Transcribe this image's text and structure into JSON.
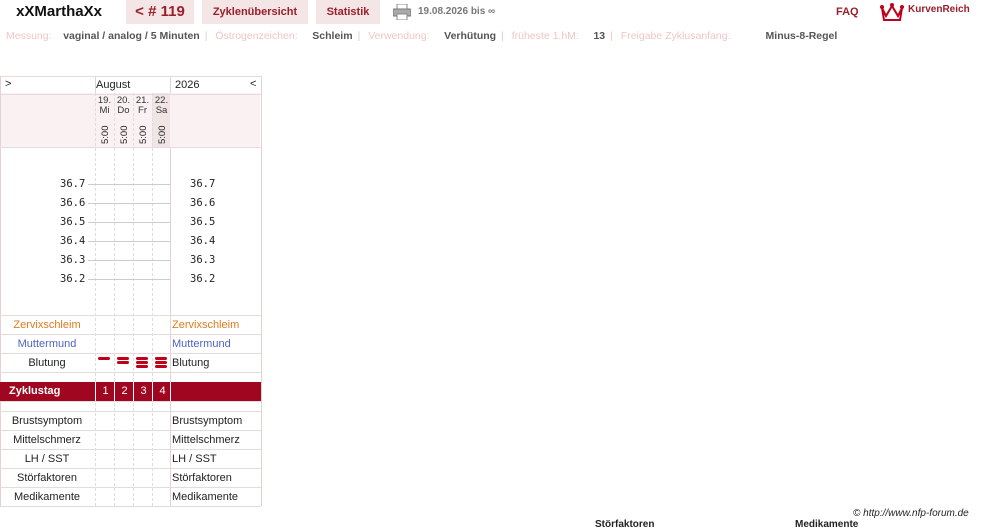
{
  "header": {
    "username": "xXMarthaXx",
    "cycle_tab": "< # 119",
    "overview_tab": "Zyklenübersicht",
    "stats_tab": "Statistik",
    "date_range": "19.08.2026 bis ∞",
    "faq": "FAQ",
    "brand": "KurvenReich"
  },
  "info": {
    "measure_label": "Messung:",
    "measure_value": "vaginal / analog / 5 Minuten",
    "estrogen_label": "Östrogenzeichen:",
    "estrogen_value": "Schleim",
    "usage_label": "Verwendung:",
    "usage_value": "Verhütung",
    "hm_label": "früheste 1.hM:",
    "hm_value": "13",
    "release_label": "Freigabe Zyklusanfang:",
    "release_value": "Minus-8-Regel"
  },
  "chart": {
    "nav_prev": ">",
    "nav_next": "<",
    "month": "August",
    "year": "2026",
    "days": [
      {
        "date": "19.",
        "weekday": "Mi",
        "time": "5:00",
        "cycle_day": "1",
        "bleeding": 1
      },
      {
        "date": "20.",
        "weekday": "Do",
        "time": "5:00",
        "cycle_day": "2",
        "bleeding": 2
      },
      {
        "date": "21.",
        "weekday": "Fr",
        "time": "5:00",
        "cycle_day": "3",
        "bleeding": 3
      },
      {
        "date": "22.",
        "weekday": "Sa",
        "time": "5:00",
        "cycle_day": "4",
        "bleeding": 3
      }
    ],
    "temps": [
      "36.7",
      "36.6",
      "36.5",
      "36.4",
      "36.3",
      "36.2"
    ],
    "rows": {
      "mucus": "Zervixschleim",
      "cervix": "Muttermund",
      "bleeding": "Blutung",
      "cycle_day": "Zyklustag",
      "breast": "Brustsymptom",
      "midpain": "Mittelschmerz",
      "lh": "LH / SST",
      "disturb": "Störfaktoren",
      "meds": "Medikamente"
    },
    "colors": {
      "mucus": "#e07a1f",
      "cervix": "#4e63c4",
      "accent": "#a0061f",
      "blood": "#c0001a"
    }
  },
  "footer": {
    "copyright": "© http://www.nfp-forum.de",
    "cut_left": "Störfaktoren",
    "cut_right": "Medikamente"
  }
}
